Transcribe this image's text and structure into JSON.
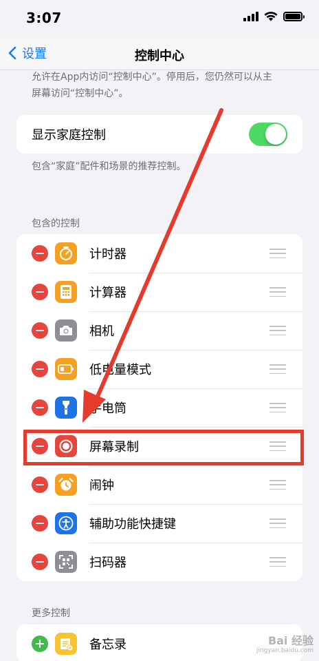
{
  "status": {
    "time": "3:07"
  },
  "nav": {
    "back_label": "设置",
    "title": "控制中心"
  },
  "intro_text": [
    "允许在App内访问“控制中心”。停用后，您仍然可以从主",
    "屏幕访问“控制中心”。"
  ],
  "home_controls": {
    "label": "显示家庭控制",
    "enabled": true,
    "footnote": "包含“家庭”配件和场景的推荐控制。"
  },
  "included": {
    "header": "包含的控制",
    "items": [
      {
        "label": "计时器",
        "icon": "timer-icon",
        "color": "#f5a023"
      },
      {
        "label": "计算器",
        "icon": "calculator-icon",
        "color": "#f5a023"
      },
      {
        "label": "相机",
        "icon": "camera-icon",
        "color": "#8e8e93"
      },
      {
        "label": "低电量模式",
        "icon": "battery-icon",
        "color": "#f5a023"
      },
      {
        "label": "手电筒",
        "icon": "flashlight-icon",
        "color": "#1e73e6"
      },
      {
        "label": "屏幕录制",
        "icon": "screen-record-icon",
        "color": "#e5453a"
      },
      {
        "label": "闹钟",
        "icon": "alarm-icon",
        "color": "#f5a023"
      },
      {
        "label": "辅助功能快捷键",
        "icon": "accessibility-icon",
        "color": "#1e73e6"
      },
      {
        "label": "扫码器",
        "icon": "qr-scanner-icon",
        "color": "#8e8e93"
      }
    ]
  },
  "more": {
    "header": "更多控制",
    "items": [
      {
        "label": "备忘录",
        "icon": "notes-icon",
        "color": "#f7c42f"
      }
    ]
  },
  "annotation": {
    "highlight_color": "#e53b2c",
    "highlighted_item": "屏幕录制"
  },
  "watermark": {
    "text": "Bai 经验",
    "url": "jingyan.baidu.com"
  }
}
